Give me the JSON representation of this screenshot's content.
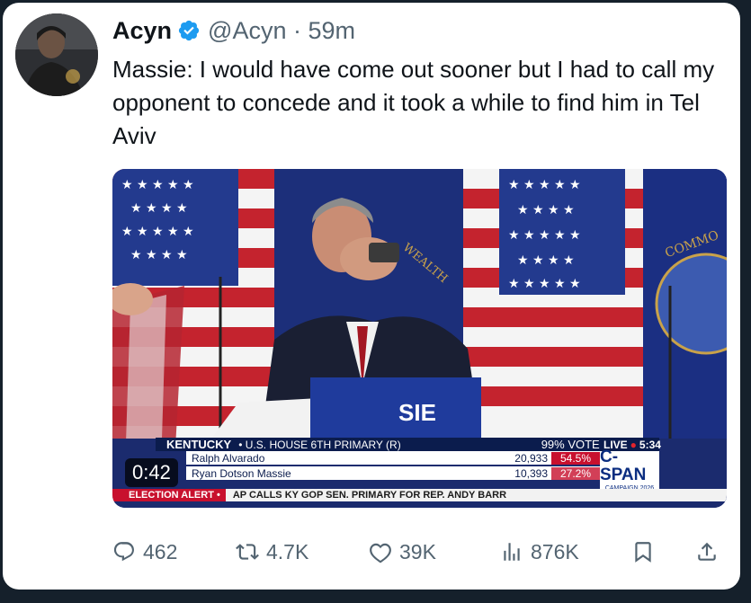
{
  "tweet": {
    "author_name": "Acyn",
    "handle_time": "@Acyn · 59m",
    "text": "Massie: I would have come out sooner but I had to call my opponent to concede and it took a while to find him in Tel Aviv"
  },
  "video": {
    "duration": "0:42",
    "podium_text": "SIE",
    "banner_text": "WEALTH",
    "seal_text": "COMMO",
    "ticker": {
      "state": "KENTUCKY",
      "race": "• U.S. HOUSE 6TH PRIMARY (R)",
      "votes_in": "99% VOTES IN",
      "live": "LIVE",
      "time": "5:34",
      "candidates": [
        {
          "name": "Ralph Alvarado",
          "votes": "20,933",
          "pct": "54.5%"
        },
        {
          "name": "Ryan Dotson Massie",
          "votes": "10,393",
          "pct": "27.2%"
        }
      ],
      "network": "C-SPAN",
      "campaign": "CAMPAIGN 2026",
      "alert_label": "ELECTION ALERT •",
      "alert_text": "AP CALLS KY GOP SEN. PRIMARY FOR REP. ANDY BARR"
    }
  },
  "actions": {
    "replies": "462",
    "reposts": "4.7K",
    "likes": "39K",
    "views": "876K"
  },
  "colors": {
    "verified": "#1d9bf0",
    "ticker_navy": "#0b1c4d",
    "alert_red": "#c8102e"
  }
}
